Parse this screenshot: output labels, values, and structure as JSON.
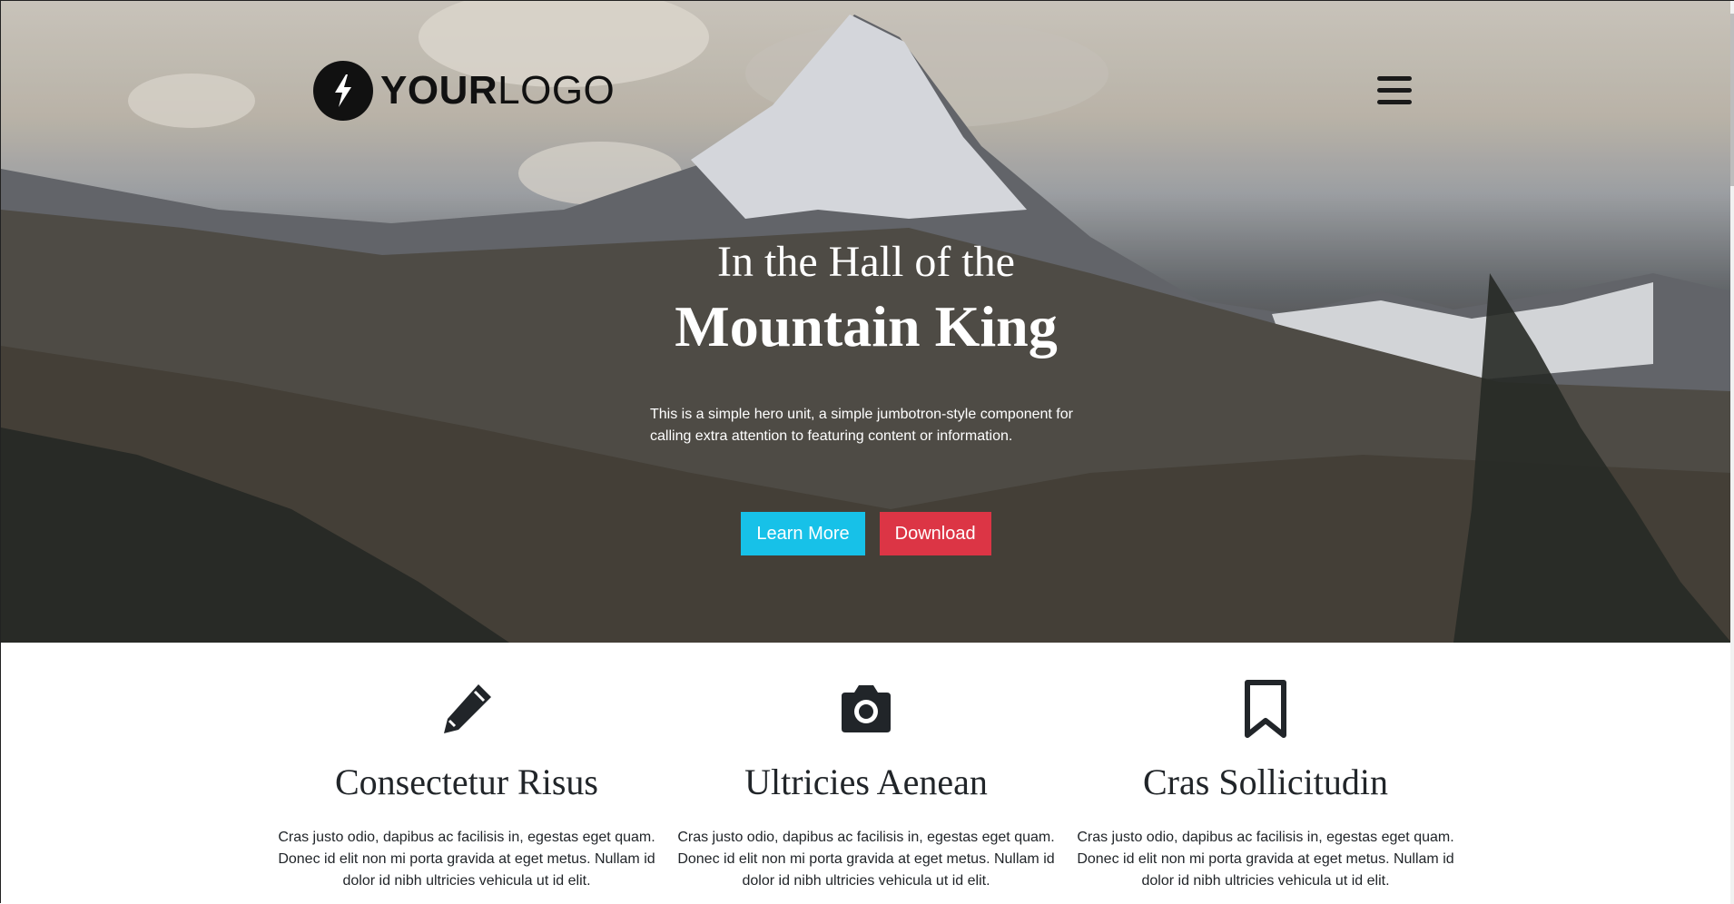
{
  "header": {
    "logo_bold": "YOUR",
    "logo_light": "LOGO",
    "menu_icon": "hamburger-menu-icon",
    "logo_icon": "lightning-bolt-icon"
  },
  "hero": {
    "title_line1": "In the Hall of the",
    "title_line2": "Mountain King",
    "description": "This is a simple hero unit, a simple jumbotron-style component for calling extra attention to featuring content or information.",
    "buttons": {
      "learn_more": "Learn More",
      "download": "Download"
    },
    "colors": {
      "learn_more": "#17c1e8",
      "download": "#dc3545"
    }
  },
  "features": [
    {
      "icon": "pencil-icon",
      "title": "Consectetur Risus",
      "text": "Cras justo odio, dapibus ac facilisis in, egestas eget quam. Donec id elit non mi porta gravida at eget metus. Nullam id dolor id nibh ultricies vehicula ut id elit."
    },
    {
      "icon": "camera-icon",
      "title": "Ultricies Aenean",
      "text": "Cras justo odio, dapibus ac facilisis in, egestas eget quam. Donec id elit non mi porta gravida at eget metus. Nullam id dolor id nibh ultricies vehicula ut id elit."
    },
    {
      "icon": "bookmark-icon",
      "title": "Cras Sollicitudin",
      "text": "Cras justo odio, dapibus ac facilisis in, egestas eget quam. Donec id elit non mi porta gravida at eget metus. Nullam id dolor id nibh ultricies vehicula ut id elit."
    }
  ]
}
